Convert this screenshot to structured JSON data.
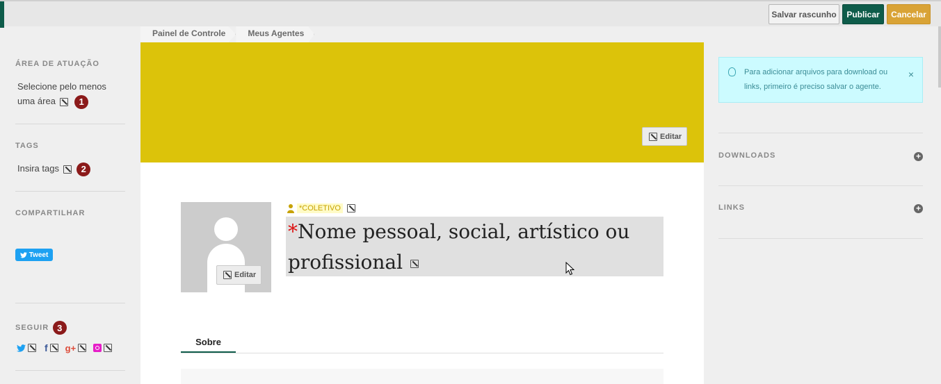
{
  "toolbar": {
    "draft_label": "Salvar rascunho",
    "publish_label": "Publicar",
    "cancel_label": "Cancelar"
  },
  "breadcrumb": [
    "Painel de Controle",
    "Meus Agentes"
  ],
  "sidebar": {
    "area": {
      "title": "ÁREA DE ATUAÇÃO",
      "text": "Selecione pelo menos uma área",
      "badge": "1"
    },
    "tags": {
      "title": "TAGS",
      "text": "Insira tags",
      "badge": "2"
    },
    "share": {
      "title": "COMPARTILHAR",
      "tweet_label": "Tweet"
    },
    "follow": {
      "title": "SEGUIR",
      "badge": "3"
    }
  },
  "profile": {
    "cover_edit_label": "Editar",
    "avatar_edit_label": "Editar",
    "type_label": "*COLETIVO",
    "name_required": "*",
    "name_placeholder": "Nome pessoal, social, artístico ou profissional",
    "tabs": [
      "Sobre"
    ]
  },
  "right": {
    "alert_text": "Para adicionar arquivos para download ou links, primeiro é preciso salvar o agente.",
    "alert_close": "×",
    "downloads_title": "DOWNLOADS",
    "links_title": "LINKS"
  },
  "colors": {
    "accent": "#0e5c4a",
    "cancel": "#d9a336",
    "cover": "#dcc30a",
    "badge": "#8b1a1a",
    "alert_bg": "#ccfbff"
  }
}
